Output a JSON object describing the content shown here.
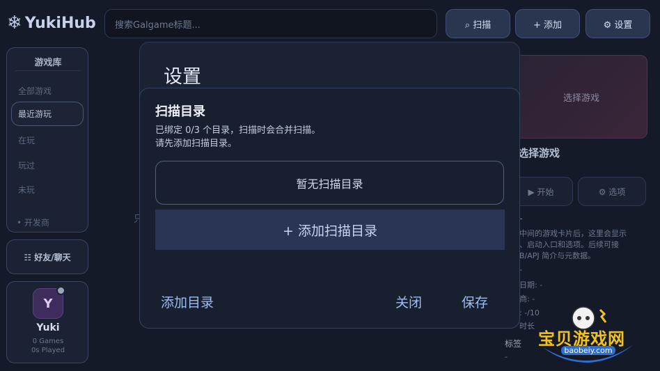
{
  "header": {
    "logo_text": "YukiHub",
    "search_placeholder": "搜索Galgame标题...",
    "scan_btn": "⌕ 扫描",
    "add_btn": "+ 添加",
    "settings_btn": "⚙ 设置"
  },
  "sidebar": {
    "title": "游戏库",
    "items": [
      {
        "label": "全部游戏"
      },
      {
        "label": "最近游玩"
      },
      {
        "label": "在玩"
      },
      {
        "label": "玩过"
      },
      {
        "label": "未玩"
      },
      {
        "label": "• 开发商"
      }
    ],
    "friends_btn": "☷ 好友/聊天"
  },
  "profile": {
    "avatar_letter": "Y",
    "name": "Yuki",
    "games": "0 Games",
    "played": "0s Played"
  },
  "main_bg_text": "只",
  "right_panel": {
    "cover_placeholder": "选择游戏",
    "title": "选择游戏",
    "start_btn": "▶ 开始",
    "options_btn": "⚙ 选项",
    "desc_lines": [
      "中间的游戏卡片后，这里会显示",
      "、启动入口和选项。后续可接",
      "B/APJ 简介与元数据。"
    ],
    "dash": "-",
    "release_date": "日期: -",
    "developer": "商: -",
    "rating": ": -/10",
    "playtime": "时长",
    "tags_label": "标签",
    "tags_value": "-"
  },
  "settings_dialog": {
    "title": "设置"
  },
  "scan_dialog": {
    "title": "扫描目录",
    "desc_line1": "已绑定 0/3 个目录，扫描时会合并扫描。",
    "desc_line2": "请先添加扫描目录。",
    "empty_text": "暂无扫描目录",
    "add_bar": "+ 添加扫描目录",
    "add_dir_btn": "添加目录",
    "close_btn": "关闭",
    "save_btn": "保存"
  },
  "watermark": {
    "title": "宝贝游戏网",
    "url": "baobeiy.com"
  }
}
